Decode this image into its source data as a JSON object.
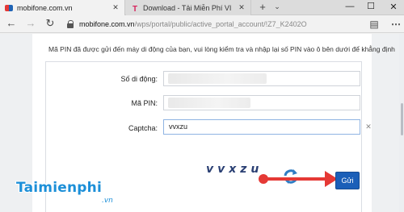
{
  "browser": {
    "tabs": [
      {
        "label": "mobifone.com.vn",
        "active": true
      },
      {
        "label": "Download - Tải Miễn Phí VI",
        "active": false
      }
    ],
    "address": {
      "domain": "mobifone.com.vn",
      "path": "/wps/portal/public/active_portal_account/!Z7_K2402O"
    }
  },
  "form": {
    "notice": "Mã PIN đã được gửi đến máy di động của bạn, vui lòng kiểm tra và nhập lại số PIN vào ô bên dưới để khẳng định",
    "phone_label": "Số di động:",
    "pin_label": "Mã PIN:",
    "captcha_label": "Captcha:",
    "captcha_value": "vvxzu",
    "captcha_image_text": "vvxzu",
    "submit_label": "Gửi"
  },
  "watermark": {
    "brand": "Taimienphi",
    "suffix": ".vn"
  },
  "colors": {
    "button": "#1b5fb8",
    "arrow": "#e53935",
    "brand": "#1c8fd8"
  }
}
